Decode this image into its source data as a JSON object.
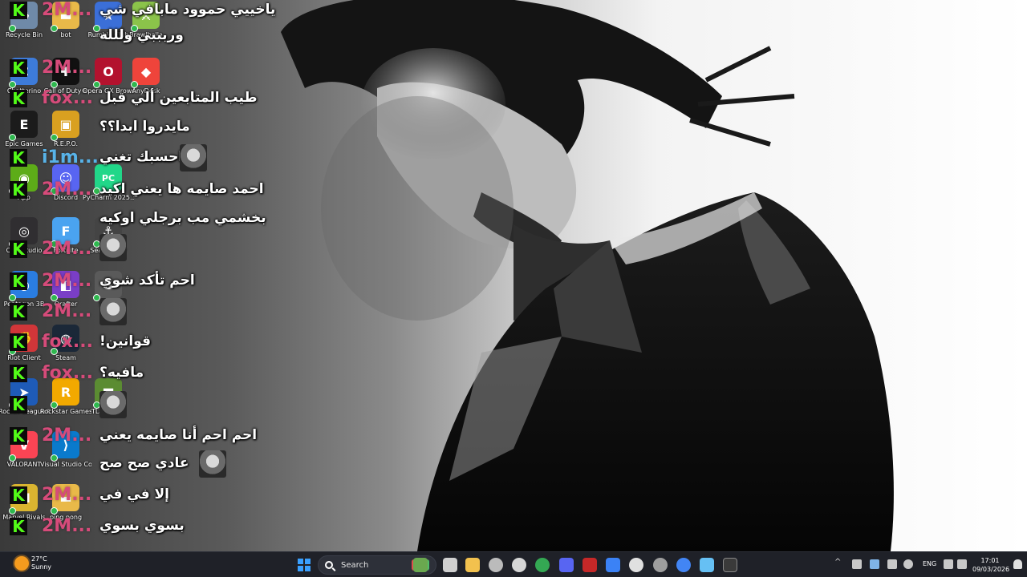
{
  "desktop": {
    "icons": [
      {
        "label": "Recycle Bin",
        "icon": "recycle-bin-icon",
        "color": "#6f8aa8",
        "glyph": "♻"
      },
      {
        "label": "bot",
        "icon": "folder-icon",
        "color": "#e9b949",
        "glyph": "▬"
      },
      {
        "label": "Rumble Club",
        "icon": "rumble-club-icon",
        "color": "#3b6fd8",
        "glyph": "★"
      },
      {
        "label": "Brawlhalla",
        "icon": "brawlhalla-icon",
        "color": "#8bc34a",
        "glyph": "⚔"
      },
      {
        "label": "Chatterino",
        "icon": "chatterino-icon",
        "color": "#3d7bd9",
        "glyph": "C"
      },
      {
        "label": "Call of Duty®",
        "icon": "call-of-duty-icon",
        "color": "#111111",
        "glyph": "✚"
      },
      {
        "label": "Opera GX Browser",
        "icon": "opera-gx-icon",
        "color": "#b3122e",
        "glyph": "O"
      },
      {
        "label": "AnyDesk",
        "icon": "anydesk-icon",
        "color": "#ef443b",
        "glyph": "◆"
      },
      {
        "label": "Epic Games",
        "icon": "epic-games-icon",
        "color": "#1b1b1b",
        "glyph": "E"
      },
      {
        "label": "R.E.P.O.",
        "icon": "repo-icon",
        "color": "#d9a020",
        "glyph": "▣"
      },
      {
        "label": "App",
        "icon": "nvidia-icon",
        "color": "#5dac18",
        "glyph": "◉"
      },
      {
        "label": "Discord",
        "icon": "discord-icon",
        "color": "#5865f2",
        "glyph": "☺"
      },
      {
        "label": "PyCharm 2025.3",
        "icon": "pycharm-icon",
        "color": "#21d789",
        "glyph": "PC"
      },
      {
        "label": "OBS Studio",
        "icon": "obs-icon",
        "color": "#302e31",
        "glyph": "◎"
      },
      {
        "label": "Fortnite",
        "icon": "fortnite-icon",
        "color": "#4aa3f0",
        "glyph": "F"
      },
      {
        "label": "Sea Shanty",
        "icon": "game-icon",
        "color": "#444444",
        "glyph": "⚓"
      },
      {
        "label": "Pentagon 3B",
        "icon": "chrome-icon",
        "color": "#2a7de1",
        "glyph": "◐"
      },
      {
        "label": "Orafter",
        "icon": "orafter-icon",
        "color": "#7a3ec7",
        "glyph": "◧"
      },
      {
        "label": "SILEN",
        "icon": "silent-icon",
        "color": "#5a5a5a",
        "glyph": "S"
      },
      {
        "label": "Riot Client",
        "icon": "riot-client-icon",
        "color": "#d13639",
        "glyph": "✊"
      },
      {
        "label": "Steam",
        "icon": "steam-icon",
        "color": "#1b2838",
        "glyph": "◍"
      },
      {
        "label": "Rocket League®",
        "icon": "rocket-league-icon",
        "color": "#1e5bb8",
        "glyph": "➤"
      },
      {
        "label": "Rockstar Games ...",
        "icon": "rockstar-icon",
        "color": "#f2a900",
        "glyph": "R"
      },
      {
        "label": "TLauncher",
        "icon": "minecraft-icon",
        "color": "#5b8c32",
        "glyph": "■"
      },
      {
        "label": "VALORANT",
        "icon": "valorant-icon",
        "color": "#fa4454",
        "glyph": "V"
      },
      {
        "label": "Visual Studio Code",
        "icon": "vscode-icon",
        "color": "#0a7acc",
        "glyph": "⟩"
      },
      {
        "label": "Marvel Rivals",
        "icon": "marvel-rivals-icon",
        "color": "#d9b430",
        "glyph": "M"
      },
      {
        "label": "ping pong",
        "icon": "folder-icon",
        "color": "#e9b949",
        "glyph": "▬"
      }
    ]
  },
  "chat": {
    "messages": [
      {
        "user": "2M...",
        "user_color": "pink",
        "text": "ياخييي حموود مابافي شي"
      },
      {
        "user": "",
        "user_color": "pink",
        "text": "وربببي وللله"
      },
      {
        "user": "2M...",
        "user_color": "pink",
        "text": ""
      },
      {
        "user": "fox...",
        "user_color": "pink",
        "text": "طيب المتابعين ألي قبل"
      },
      {
        "user": "",
        "user_color": "pink",
        "text": "مايدروا ابدا؟؟"
      },
      {
        "user": "i1m...",
        "user_color": "blue",
        "text": "احسبك تغني"
      },
      {
        "user": "2M...",
        "user_color": "pink",
        "text": "احمد صايمه ها يعني اكيد"
      },
      {
        "user": "",
        "user_color": "pink",
        "text": "بخشمي مب برجلي اوكيه"
      },
      {
        "user": "2M...",
        "user_color": "pink",
        "text": ""
      },
      {
        "user": "2M...",
        "user_color": "pink",
        "text": "احم تأكد شوي"
      },
      {
        "user": "2M...",
        "user_color": "pink",
        "text": ""
      },
      {
        "user": "fox...",
        "user_color": "pink",
        "text": "قوانين!"
      },
      {
        "user": "fox...",
        "user_color": "pink",
        "text": "مافيه؟"
      },
      {
        "user": "",
        "user_color": "pink",
        "text": ""
      },
      {
        "user": "2M...",
        "user_color": "pink",
        "text": "احم احم أنا صايمه يعني"
      },
      {
        "user": "",
        "user_color": "pink",
        "text": "عادي صح صح"
      },
      {
        "user": "2M...",
        "user_color": "pink",
        "text": "إلا في في"
      },
      {
        "user": "2M...",
        "user_color": "pink",
        "text": "بسوي بسوي"
      }
    ],
    "platform_badge": "K",
    "colors": {
      "pink": "#d64b7a",
      "blue": "#58b3e8",
      "kick": "#53fc18"
    }
  },
  "taskbar": {
    "weather": {
      "temp": "27°C",
      "condition": "Sunny"
    },
    "search_placeholder": "Search",
    "pinned": [
      {
        "icon": "widgets-icon",
        "color": "#6aa84f"
      },
      {
        "icon": "task-view-icon",
        "color": "#d0d0d0"
      },
      {
        "icon": "file-explorer-icon",
        "color": "#f2c14e"
      },
      {
        "icon": "obs-taskbar-icon",
        "color": "#bbbbbb"
      },
      {
        "icon": "settings-icon",
        "color": "#d6d6d6"
      },
      {
        "icon": "chrome-taskbar-icon",
        "color": "#34a853"
      },
      {
        "icon": "discord-taskbar-icon",
        "color": "#5865f2"
      },
      {
        "icon": "dj-app-icon",
        "color": "#c62828"
      },
      {
        "icon": "store-icon",
        "color": "#3b82f6"
      },
      {
        "icon": "chatterino-taskbar-icon",
        "color": "#e0e0e0"
      },
      {
        "icon": "app-icon",
        "color": "#9e9e9e"
      },
      {
        "icon": "chrome-beta-icon",
        "color": "#4285f4"
      },
      {
        "icon": "steam-taskbar-icon",
        "color": "#66c0f4"
      },
      {
        "icon": "terminal-icon",
        "color": "#3a3a3a"
      }
    ],
    "tray": {
      "language": "ENG",
      "time": "17:01",
      "date": "09/03/2026"
    }
  }
}
